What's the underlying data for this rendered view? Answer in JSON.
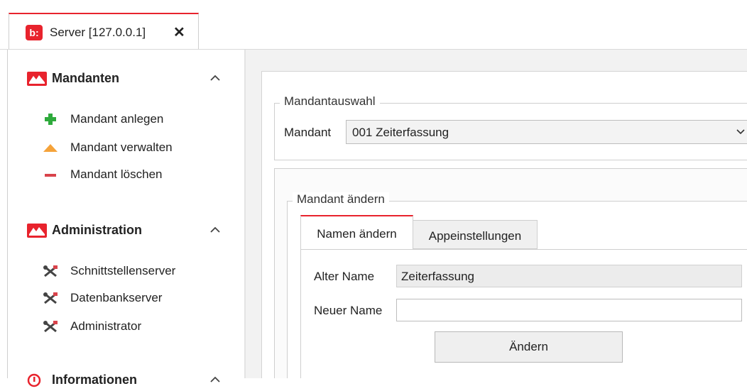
{
  "tab": {
    "logo": "b:",
    "title": "Server [127.0.0.1]",
    "close": "✕"
  },
  "sidebar": {
    "groups": [
      {
        "title": "Mandanten",
        "items": [
          {
            "label": "Mandant anlegen",
            "icon": "plus-icon"
          },
          {
            "label": "Mandant verwalten",
            "icon": "triangle-icon"
          },
          {
            "label": "Mandant löschen",
            "icon": "minus-icon"
          }
        ]
      },
      {
        "title": "Administration",
        "items": [
          {
            "label": "Schnittstellenserver",
            "icon": "tools-icon"
          },
          {
            "label": "Datenbankserver",
            "icon": "tools-icon"
          },
          {
            "label": "Administrator",
            "icon": "tools-icon"
          }
        ]
      },
      {
        "title": "Informationen"
      }
    ]
  },
  "main": {
    "mandantauswahl": {
      "legend": "Mandantauswahl",
      "label": "Mandant",
      "selected": "001 Zeiterfassung"
    },
    "mandant_aendern": {
      "legend": "Mandant ändern",
      "tabs": [
        "Namen ändern",
        "Appeinstellungen"
      ],
      "alter_name_label": "Alter Name",
      "alter_name_value": "Zeiterfassung",
      "neuer_name_label": "Neuer Name",
      "neuer_name_value": "",
      "button": "Ändern"
    }
  },
  "colors": {
    "accent": "#e8232d",
    "plus": "#2eaa3c",
    "triangle": "#f5a33a",
    "minus": "#d9434b"
  }
}
